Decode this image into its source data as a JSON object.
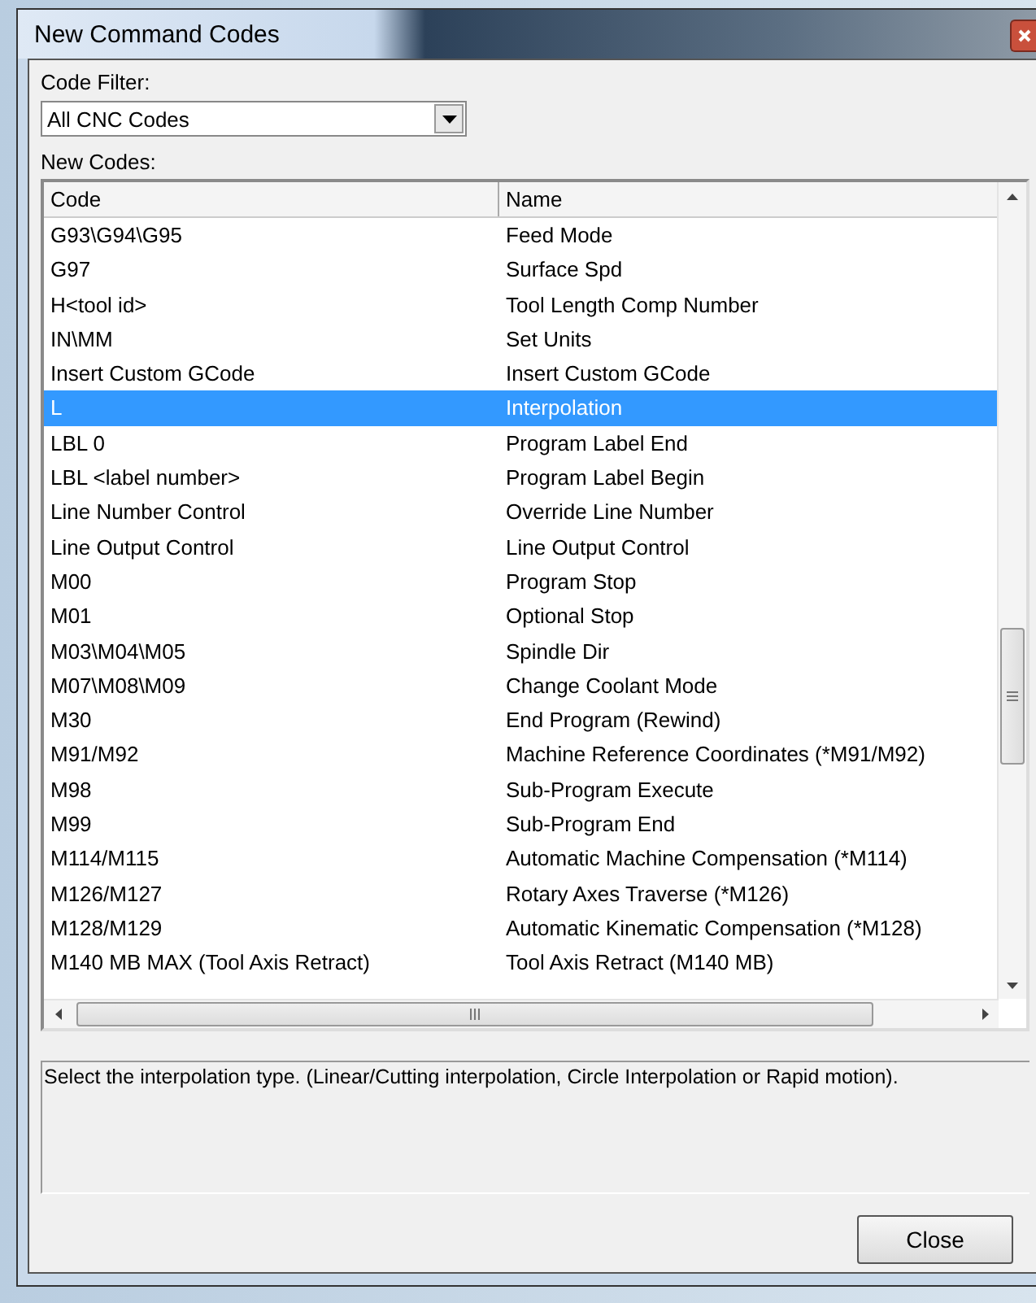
{
  "window": {
    "title": "New Command Codes"
  },
  "code_filter": {
    "label": "Code Filter:",
    "value": "All CNC Codes"
  },
  "list": {
    "label": "New Codes:",
    "columns": [
      "Code",
      "Name"
    ],
    "rows": [
      {
        "code": "G93\\G94\\G95",
        "name": "Feed Mode",
        "selected": false
      },
      {
        "code": "G97",
        "name": "Surface Spd",
        "selected": false
      },
      {
        "code": "H<tool id>",
        "name": "Tool Length Comp Number",
        "selected": false
      },
      {
        "code": "IN\\MM",
        "name": "Set Units",
        "selected": false
      },
      {
        "code": "Insert Custom GCode",
        "name": "Insert Custom GCode",
        "selected": false
      },
      {
        "code": "L",
        "name": "Interpolation",
        "selected": true
      },
      {
        "code": "LBL 0",
        "name": "Program Label End",
        "selected": false
      },
      {
        "code": "LBL <label number>",
        "name": "Program Label Begin",
        "selected": false
      },
      {
        "code": "Line Number Control",
        "name": "Override Line Number",
        "selected": false
      },
      {
        "code": "Line Output Control",
        "name": "Line Output Control",
        "selected": false
      },
      {
        "code": "M00",
        "name": "Program Stop",
        "selected": false
      },
      {
        "code": "M01",
        "name": "Optional Stop",
        "selected": false
      },
      {
        "code": "M03\\M04\\M05",
        "name": "Spindle Dir",
        "selected": false
      },
      {
        "code": "M07\\M08\\M09",
        "name": "Change Coolant Mode",
        "selected": false
      },
      {
        "code": "M30",
        "name": "End Program (Rewind)",
        "selected": false
      },
      {
        "code": "M91/M92",
        "name": "Machine Reference Coordinates (*M91/M92)",
        "selected": false
      },
      {
        "code": "M98",
        "name": "Sub-Program Execute",
        "selected": false
      },
      {
        "code": "M99",
        "name": "Sub-Program End",
        "selected": false
      },
      {
        "code": "M114/M115",
        "name": "Automatic Machine Compensation (*M114)",
        "selected": false
      },
      {
        "code": "M126/M127",
        "name": "Rotary Axes Traverse (*M126)",
        "selected": false
      },
      {
        "code": "M128/M129",
        "name": "Automatic Kinematic Compensation (*M128)",
        "selected": false
      },
      {
        "code": "M140 MB MAX (Tool Axis Retract)",
        "name": "Tool Axis Retract (M140 MB)",
        "selected": false
      }
    ]
  },
  "description": "Select the interpolation type. (Linear/Cutting interpolation, Circle Interpolation or Rapid motion).",
  "buttons": [
    "Close"
  ]
}
